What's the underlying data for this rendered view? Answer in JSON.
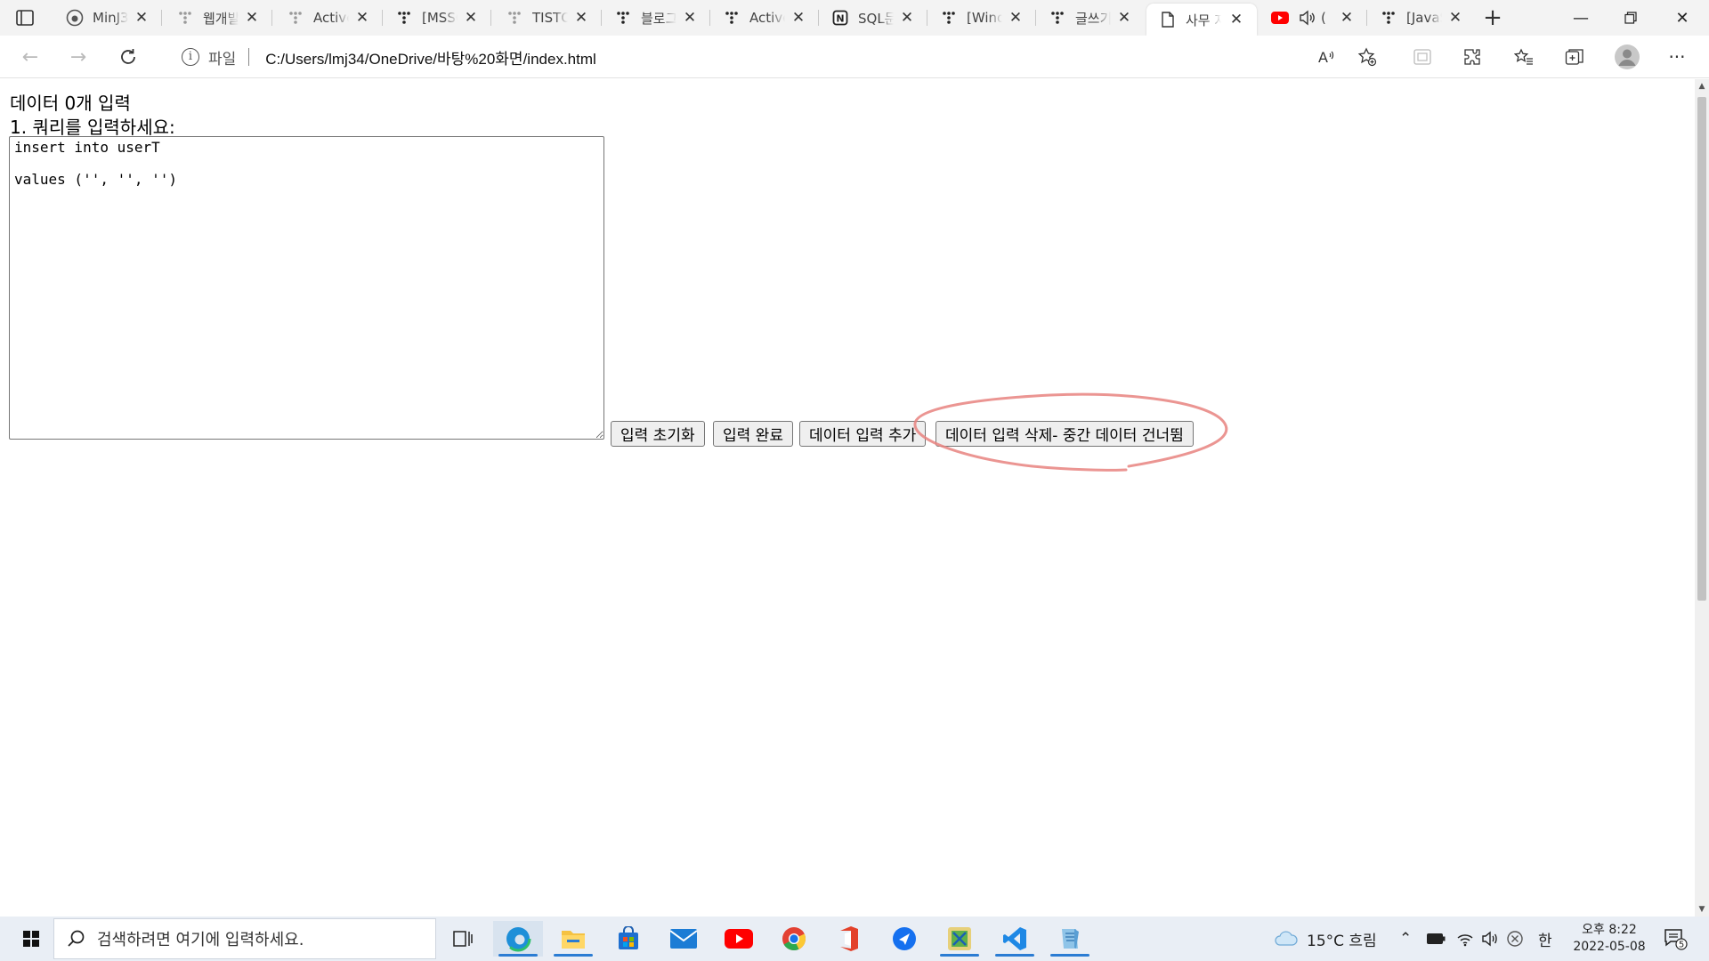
{
  "browser": {
    "tabs": [
      {
        "title": "MinJ3",
        "icon": "github-icon",
        "active": false
      },
      {
        "title": "웹개발",
        "icon": "tistory-icon",
        "active": false
      },
      {
        "title": "Active",
        "icon": "tistory-icon",
        "active": false
      },
      {
        "title": "[MSSQ",
        "icon": "tistory-icon",
        "active": false
      },
      {
        "title": "TISTO",
        "icon": "tistory-icon",
        "active": false
      },
      {
        "title": "블로그",
        "icon": "tistory-icon",
        "active": false
      },
      {
        "title": "Active",
        "icon": "tistory-icon",
        "active": false
      },
      {
        "title": "SQL문",
        "icon": "notion-icon",
        "active": false
      },
      {
        "title": "[Wind",
        "icon": "tistory-icon",
        "active": false
      },
      {
        "title": "글쓰기",
        "icon": "tistory-icon",
        "active": false
      },
      {
        "title": "사무 자",
        "icon": "page-icon",
        "active": true
      },
      {
        "title": "(",
        "icon": "youtube-icon",
        "active": false,
        "audio": true
      },
      {
        "title": "[JavaS",
        "icon": "tistory-icon",
        "active": false
      }
    ],
    "address": {
      "scheme_label": "파일",
      "url": "C:/Users/lmj34/OneDrive/바탕%20화면/index.html"
    }
  },
  "page": {
    "heading": "데이터 0개 입력",
    "prompt": "1. 쿼리를 입력하세요:",
    "query_value": "insert into userT\n\nvalues ('', '', '')",
    "buttons": {
      "reset": "입력 초기화",
      "complete": "입력 완료",
      "add": "데이터 입력 추가",
      "delete": "데이터 입력 삭제- 중간 데이터 건너뜀"
    },
    "annotation_color": "#e8837f"
  },
  "taskbar": {
    "search_placeholder": "검색하려면 여기에 입력하세요.",
    "weather": "15°C  흐림",
    "ime": "한",
    "time": "오후 8:22",
    "date": "2022-05-08",
    "notification_count": "5"
  }
}
